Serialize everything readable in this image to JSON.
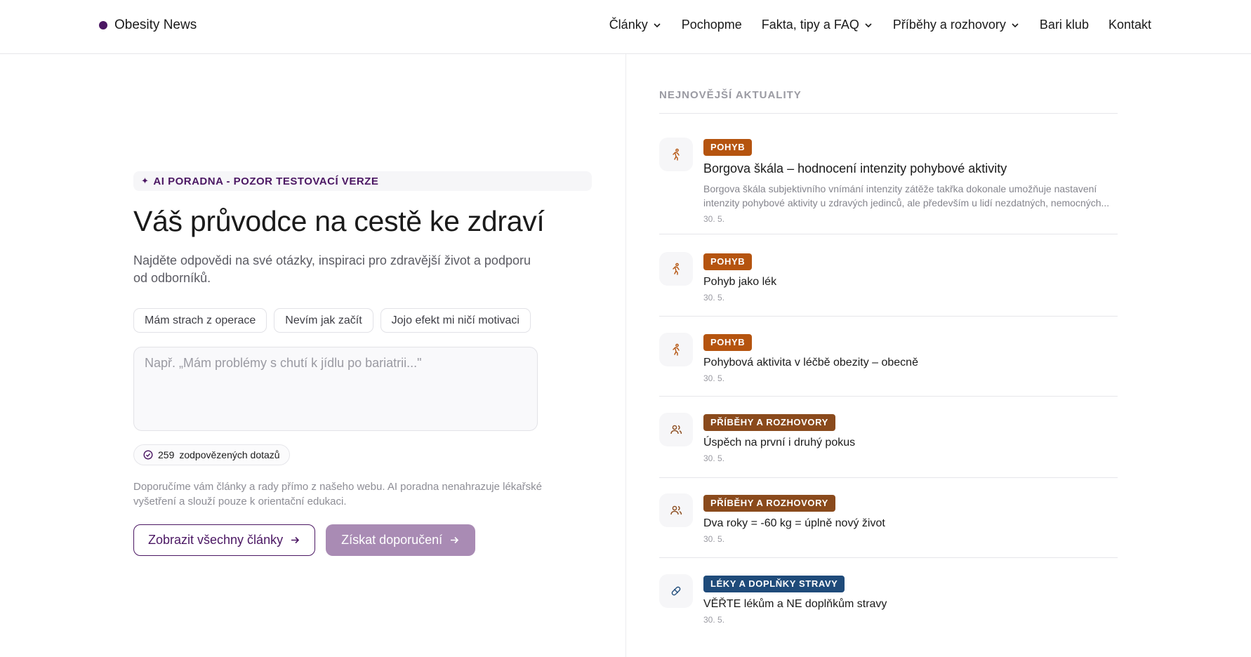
{
  "brand": {
    "name": "Obesity News",
    "color": "#4b1763"
  },
  "nav": [
    {
      "label": "Články",
      "dropdown": true
    },
    {
      "label": "Pochopme",
      "dropdown": false
    },
    {
      "label": "Fakta, tipy a FAQ",
      "dropdown": true
    },
    {
      "label": "Příběhy a rozhovory",
      "dropdown": true
    },
    {
      "label": "Bari klub",
      "dropdown": false
    },
    {
      "label": "Kontakt",
      "dropdown": false
    }
  ],
  "hero": {
    "badge": "AI PORADNA - POZOR TESTOVACÍ VERZE",
    "badge_icon": "sparkle-icon",
    "title": "Váš průvodce na cestě ke zdraví",
    "subtitle": "Najděte odpovědi na své otázky, inspiraci pro zdravější život a podporu od odborníků.",
    "chips": [
      "Mám strach z operace",
      "Nevím jak začít",
      "Jojo efekt mi ničí motivaci"
    ],
    "textarea_placeholder": "Např. „Mám problémy s chutí k jídlu po bariatrii...\"",
    "textarea_value": "",
    "counter_value": "259",
    "counter_label": "zodpovězených dotazů",
    "disclaimer": "Doporučíme vám články a rady přímo z našeho webu. AI poradna nenahrazuje lékařské vyšetření a slouží pouze k orientační edukaci.",
    "btn_all_articles": "Zobrazit všechny články",
    "btn_recommend": "Získat doporučení",
    "accent_color": "#4b1763",
    "recommend_color": "#a98bb4"
  },
  "news": {
    "heading": "NEJNOVĚJŠÍ AKTUALITY",
    "items": [
      {
        "icon": "running-icon",
        "tag": "POHYB",
        "tag_color": "#b5540f",
        "title": "Borgova škála – hodnocení intenzity pohybové aktivity",
        "excerpt": "Borgova škála subjektivního vnímání intenzity zátěže takřka dokonale umožňuje nastavení intenzity pohybové aktivity u zdravých jedinců, ale především u lidí nezdatných, nemocných...",
        "date": "30. 5."
      },
      {
        "icon": "running-icon",
        "tag": "POHYB",
        "tag_color": "#b5540f",
        "title": "Pohyb jako lék",
        "excerpt": "",
        "date": "30. 5."
      },
      {
        "icon": "running-icon",
        "tag": "POHYB",
        "tag_color": "#b5540f",
        "title": "Pohybová aktivita v léčbě obezity – obecně",
        "excerpt": "",
        "date": "30. 5."
      },
      {
        "icon": "users-icon",
        "tag": "PŘÍBĚHY A ROZHOVORY",
        "tag_color": "#8a4a1c",
        "title": "Úspěch na první i druhý pokus",
        "excerpt": "",
        "date": "30. 5."
      },
      {
        "icon": "users-icon",
        "tag": "PŘÍBĚHY A ROZHOVORY",
        "tag_color": "#8a4a1c",
        "title": "Dva roky = -60 kg = úplně nový život",
        "excerpt": "",
        "date": "30. 5."
      },
      {
        "icon": "pill-icon",
        "tag": "LÉKY A DOPLŇKY STRAVY",
        "tag_color": "#1f4b7a",
        "title": "VĚŘTE lékům a NE doplňkům stravy",
        "excerpt": "",
        "date": "30. 5."
      }
    ]
  }
}
